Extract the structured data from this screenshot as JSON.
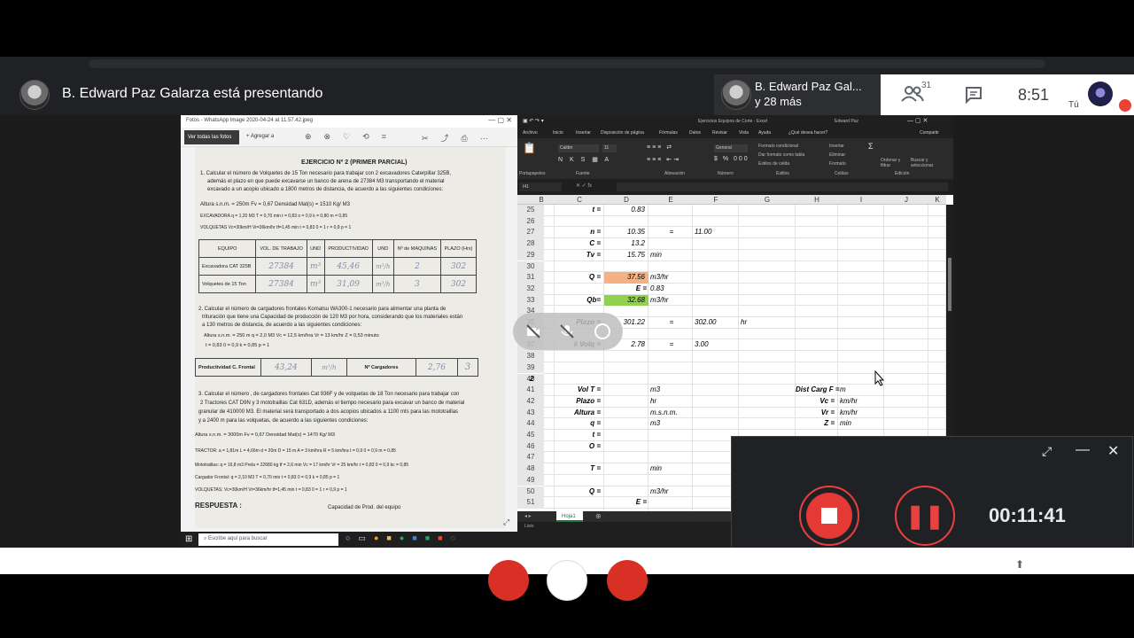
{
  "meet": {
    "presenter_banner": "B. Edward Paz Galarza está presentando",
    "tile_name": "B. Edward Paz Gal...",
    "tile_more": "y 28 más",
    "participants_count": "31",
    "clock": "8:51",
    "self_label": "Tú"
  },
  "photo_viewer": {
    "title": "Fotos - WhatsApp Image 2020-04-24 at 11.57.42.jpeg",
    "see_all": "Ver todas las fotos",
    "add": "+ Agregar a",
    "paper": {
      "heading": "EJERCICIO Nº 2 (PRIMER PARCIAL)",
      "p1a": "1. Calcular el número de Volquetes de 15 Ton necesario para trabajar con 2 excavadores Caterpillar 325B,",
      "p1b": "además el plazo en que puede excavarse un banco de arena de 27384 M3 transportando el material",
      "p1c": "excavado a un acopio ubicado a 1800 metros de distancia, de acuerdo a las siguientes condiciones:",
      "l_alt": "Altura s.n.m. = 250m        Fv = 0,67        Densidad Mat(s) = 1510 Kg/ M3",
      "l_exc": "EXCAVADORA  q = 1,20 M3    T = 0,70 min    t = 0,83    o = 0,9    k = 0,80    m = 0,85",
      "l_vol": "VOLQUETAS  Vc=30km/H  Vr=36km/hr  tf=1,45 min  t = 0,83  0 = 1  r = 0,9  p = 1",
      "th": [
        "EQUIPO",
        "VOL. DE TRABAJO",
        "UND",
        "PRODUCTIVIDAD",
        "UND",
        "Nº de MAQUINAS",
        "PLAZO (Hrs)"
      ],
      "r1": [
        "Excavadora CAT 325B",
        "27384",
        "m³",
        "45,46",
        "m³/h",
        "2",
        "302"
      ],
      "r2": [
        "Volquetes de 15 Ton",
        "27384",
        "m³",
        "31,09",
        "m³/h",
        "3",
        "302"
      ],
      "p2a": "2. Calcular el número de cargadores frontales  Komatsu WA300-1 necesario para alimentar una planta de",
      "p2b": "trituración que tiene una Capacidad de producción de 120 M3 por hora, considerando que los materiales están",
      "p2c": "a 130 metros de distancia, de acuerdo a las siguientes condiciones:",
      "p2d": "Altura s.n.m. = 250 m         q = 2,0 M3    Vc = 12,5 km/hra     Vr = 13 km/hr     Z = 0,53 minuto",
      "p2e": "t = 0,83    0 = 0,9    k = 0,85    p = 1",
      "prod_label": "Productividad  C. Frontal",
      "prod_val": "43,24",
      "prod_unit": "m³/h",
      "carg_label": "Nº Cargadores",
      "carg_val": "2,76",
      "carg_n": "3",
      "p3a": "3. Calcular el número , de cargadores frontales Cat 936F y de volquetas de 18 Ton necesario para trabajar con",
      "p3b": "2 Tractores CAT D9N  y 3 mototraillas Cat 631D, además el tiempo necesario para excavar un banco de material",
      "p3c": "granular de 410000 M3. El material será transportado a dos acopios ubicados a 1100 mts  para las mototraillas",
      "p3d": "y a 2400 m para las volquetas, de acuerdo a las siguientes condiciones:",
      "p3e": "Altura s.n.m. = 3000m           Fv = 0,67          Densidad Mat(s) = 1470 Kg/ M3",
      "p3f": "TRACTOR:  a = 1,81m  L = 4,66m  d = 20m  D = 15 m  A = 3 km/hra    R = 5 km/hra    t = 0,9    0 = 0,9    m = 0,85",
      "p3g": "Mototraillas: q = 16,8 m3   Prela = 22680 kg   tf = 2,6 min   Vc = 17 km/hr   Vr = 25 km/hr   t = 0,83   0 = 0,9   kc = 0,85",
      "p3h": "Cargador Frontal: q = 2,10 M3     T = 0,70 min     t = 0,83     0 = 0,9     k = 0,85     p = 1",
      "p3i": "VOLQUETAS: Vc=30km/H  Vr=36km/hr  tf=1,45 min  t = 0,83  0 = 1  r = 0,9  p = 1",
      "respuesta": "RESPUESTA :",
      "capacidad": "Capacidad de Prod. del equipo"
    }
  },
  "taskbar": {
    "search_placeholder": "Escribe aquí para buscar"
  },
  "excel": {
    "title": "Ejercicios Equipos de Corte - Excel",
    "user": "Edward Paz",
    "menu": [
      "Archivo",
      "Inicio",
      "Insertar",
      "Disposición de página",
      "Fórmulas",
      "Datos",
      "Revisar",
      "Vista",
      "Ayuda",
      "¿Qué desea hacer?",
      "Compartir"
    ],
    "ribbon": {
      "paste": "Portapapeles",
      "font_name": "Calibri",
      "font_size": "11",
      "font_group": "Fuente",
      "align_group": "Alineación",
      "number_format": "General",
      "number_group": "Número",
      "cond_format": "Formato condicional",
      "table_format": "Dar formato como tabla",
      "cell_styles": "Estilos de celda",
      "styles_group": "Estilos",
      "insert": "Insertar",
      "delete": "Eliminar",
      "format": "Formato",
      "cells_group": "Celdas",
      "sort": "Ordenar y filtrar",
      "find": "Buscar y seleccionar",
      "edit_group": "Edición"
    },
    "name_box": "I41",
    "columns": [
      "B",
      "C",
      "D",
      "E",
      "F",
      "G",
      "H",
      "I",
      "J",
      "K"
    ],
    "rows": [
      "25",
      "26",
      "27",
      "28",
      "29",
      "30",
      "31",
      "32",
      "33",
      "34",
      "35",
      "36",
      "37",
      "38",
      "39",
      "40",
      "41",
      "42",
      "43",
      "44",
      "45",
      "46",
      "47",
      "48",
      "49",
      "50",
      "51"
    ],
    "cells": {
      "c25": "t =",
      "d25": "0.83",
      "c27": "n =",
      "d27": "10.35",
      "e27": "=",
      "f27": "11.00",
      "c28": "C =",
      "d28": "13.2",
      "c29": "Tv =",
      "d29": "15.75",
      "e29": "min",
      "c31": "Q =",
      "d31": "37.56",
      "e31": "m3/hr",
      "d32": "E =",
      "e32": "0.83",
      "c33": "Qb=",
      "d33": "32.68",
      "e33": "m3/hr",
      "c35": "Plazo =",
      "d35": "301.22",
      "e35": "=",
      "f35": "302.00",
      "g35": "hr",
      "c37": "# Volq =",
      "d37": "2.78",
      "e37": "=",
      "f37": "3.00",
      "b40": "2",
      "c41": "Vol T =",
      "e41": "m3",
      "h41": "Dist Carg F =",
      "i41": "m",
      "c42": "Plazo =",
      "e42": "hr",
      "h42": "Vc =",
      "i42": "km/hr",
      "c43": "Altura =",
      "e43": "m.s.n.m.",
      "h43": "Vr =",
      "i43": "km/hr",
      "c44": "q =",
      "e44": "m3",
      "h44": "Z =",
      "i44": "min",
      "c45": "t =",
      "c46": "O =",
      "c48": "T =",
      "e48": "min",
      "c50": "Q =",
      "e50": "m3/hr",
      "d51": "E ="
    },
    "highlight_orange": "#f4b183",
    "highlight_green": "#92d050",
    "sheet_tab": "Hoja1",
    "status": "Listo"
  },
  "recorder": {
    "time": "00:11:41"
  }
}
